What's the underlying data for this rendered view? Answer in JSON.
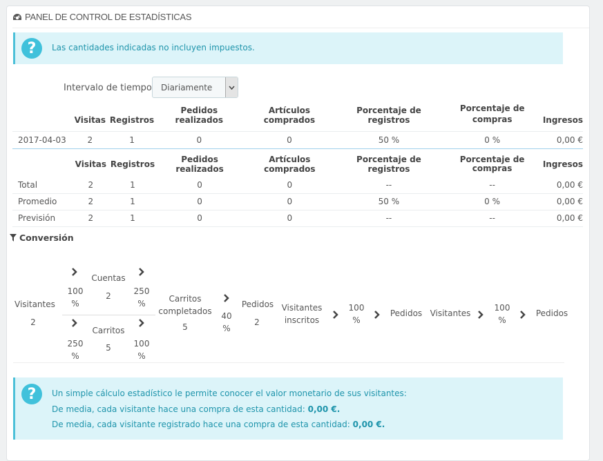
{
  "header": {
    "title": "PANEL DE CONTROL DE ESTADÍSTICAS",
    "icon": "dashboard-icon"
  },
  "alert_top": {
    "text": "Las cantidades indicadas no incluyen impuestos.",
    "icon": "question-icon"
  },
  "interval": {
    "label": "Intervalo de tiempo",
    "selected": "Diariamente"
  },
  "table1": {
    "headers": [
      "Visitas",
      "Registros",
      "Pedidos realizados",
      "Artículos comprados",
      "Porcentaje de registros",
      "Porcentaje de compras",
      "Ingresos"
    ],
    "rows": [
      {
        "label": "2017-04-03",
        "cells": [
          "2",
          "1",
          "0",
          "0",
          "50 %",
          "0 %",
          "0,00 €"
        ]
      }
    ]
  },
  "table2": {
    "headers": [
      "Visitas",
      "Registros",
      "Pedidos realizados",
      "Artículos comprados",
      "Porcentaje de registros",
      "Porcentaje de compras",
      "Ingresos"
    ],
    "rows": [
      {
        "label": "Total",
        "cells": [
          "2",
          "1",
          "0",
          "0",
          "--",
          "--",
          "0,00 €"
        ]
      },
      {
        "label": "Promedio",
        "cells": [
          "2",
          "1",
          "0",
          "0",
          "50 %",
          "0 %",
          "0,00 €"
        ]
      },
      {
        "label": "Previsión",
        "cells": [
          "2",
          "1",
          "0",
          "0",
          "--",
          "--",
          "0,00 €"
        ]
      }
    ]
  },
  "conversion": {
    "title": "Conversión",
    "visitantes_label": "Visitantes",
    "visitantes_value": "2",
    "cuentas_label": "Cuentas",
    "cuentas_value": "2",
    "pct_visit_cuentas": "100 %",
    "pct_cuentas_carritos": "250 %",
    "carritos_label": "Carritos",
    "carritos_value": "5",
    "pct_visit_carritos": "250 %",
    "pct_carritos_completados": "100 %",
    "completados_label": "Carritos completados",
    "completados_value": "5",
    "pct_completados_pedidos": "40 %",
    "pedidos_label": "Pedidos",
    "pedidos_value": "2",
    "inscritos_label": "Visitantes inscritos",
    "pct_inscritos_pedidos": "100 %",
    "pedidos_label_2": "Pedidos",
    "visitantes_label_2": "Visitantes",
    "pct_visitantes_pedidos": "100 %",
    "pedidos_label_3": "Pedidos"
  },
  "alert_bottom": {
    "line1": "Un simple cálculo estadístico le permite conocer el valor monetario de sus visitantes:",
    "line2": "De media, cada visitante hace una compra de esta cantidad:",
    "line2_value": "0,00 €.",
    "line3": "De media, cada visitante registrado hace una compra de esta cantidad:",
    "line3_value": "0,00 €."
  }
}
